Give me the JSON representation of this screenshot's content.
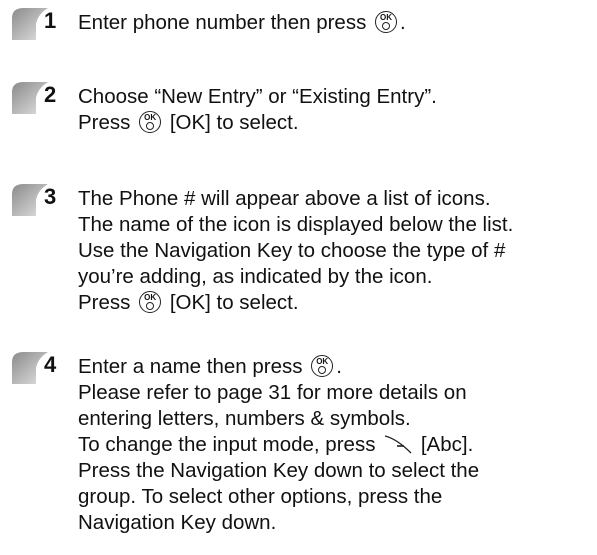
{
  "steps": [
    {
      "num": "1",
      "parts": {
        "a": "Enter phone number then press",
        "b": "."
      }
    },
    {
      "num": "2",
      "line1": "Choose “New Entry” or “Existing Entry”.",
      "line2a": "Press",
      "line2b": "[OK] to select."
    },
    {
      "num": "3",
      "line1": "The Phone # will appear above a list of icons.",
      "line2": "The name of the icon is displayed below the list.",
      "line3": "Use the Navigation Key to choose the type of #",
      "line4": "you’re adding, as indicated by the icon.",
      "line5a": "Press",
      "line5b": "[OK] to select."
    },
    {
      "num": "4",
      "line1a": "Enter a name then press",
      "line1b": ".",
      "line2": "Please refer to page 31 for more details on",
      "line3": "entering letters, numbers & symbols.",
      "line4a": "To change the input mode, press",
      "line4b": "[Abc].",
      "line5": "Press the Navigation Key down to select the",
      "line6": "group. To select other options, press the",
      "line7": "Navigation Key down."
    }
  ],
  "key_label": "OK",
  "icons": [
    "ok-key-icon",
    "right-soft-key-icon"
  ]
}
